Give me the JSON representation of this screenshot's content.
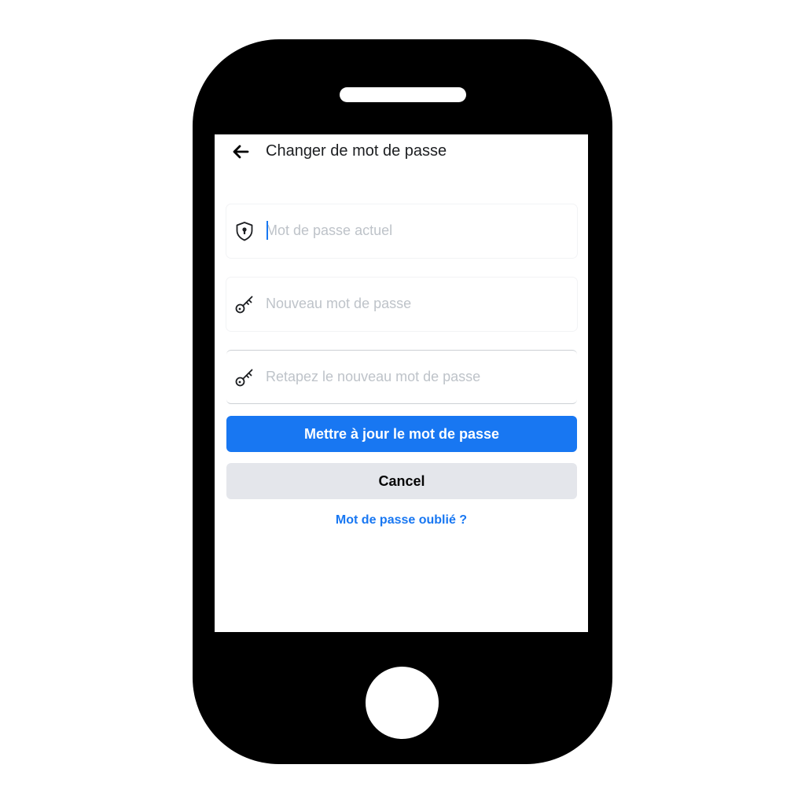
{
  "header": {
    "back_icon": "arrow-left-icon",
    "title": "Changer de mot de passe"
  },
  "form": {
    "current_password": {
      "icon": "shield-lock-icon",
      "placeholder": "Mot de passe actuel",
      "value": ""
    },
    "new_password": {
      "icon": "key-icon",
      "placeholder": "Nouveau mot de passe",
      "value": ""
    },
    "confirm_password": {
      "icon": "key-icon",
      "placeholder": "Retapez le nouveau mot de passe",
      "value": ""
    }
  },
  "actions": {
    "update_label": "Mettre à jour le mot de passe",
    "cancel_label": "Cancel",
    "forgot_label": "Mot de passe oublié ?"
  },
  "colors": {
    "primary": "#1877f2",
    "secondary_button": "#e4e6eb",
    "placeholder": "#bec3c9",
    "phone_body": "#000000"
  }
}
